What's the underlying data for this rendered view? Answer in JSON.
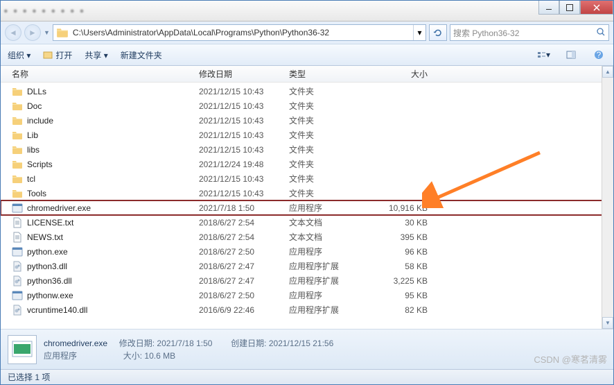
{
  "address_path": "C:\\Users\\Administrator\\AppData\\Local\\Programs\\Python\\Python36-32",
  "search_placeholder": "搜索 Python36-32",
  "toolbar": {
    "organize": "组织 ▾",
    "open": "打开",
    "share": "共享 ▾",
    "newfolder": "新建文件夹"
  },
  "columns": {
    "name": "名称",
    "date": "修改日期",
    "type": "类型",
    "size": "大小"
  },
  "files": [
    {
      "icon": "folder",
      "name": "DLLs",
      "date": "2021/12/15 10:43",
      "type": "文件夹",
      "size": ""
    },
    {
      "icon": "folder",
      "name": "Doc",
      "date": "2021/12/15 10:43",
      "type": "文件夹",
      "size": ""
    },
    {
      "icon": "folder",
      "name": "include",
      "date": "2021/12/15 10:43",
      "type": "文件夹",
      "size": ""
    },
    {
      "icon": "folder",
      "name": "Lib",
      "date": "2021/12/15 10:43",
      "type": "文件夹",
      "size": ""
    },
    {
      "icon": "folder",
      "name": "libs",
      "date": "2021/12/15 10:43",
      "type": "文件夹",
      "size": ""
    },
    {
      "icon": "folder",
      "name": "Scripts",
      "date": "2021/12/24 19:48",
      "type": "文件夹",
      "size": ""
    },
    {
      "icon": "folder",
      "name": "tcl",
      "date": "2021/12/15 10:43",
      "type": "文件夹",
      "size": ""
    },
    {
      "icon": "folder",
      "name": "Tools",
      "date": "2021/12/15 10:43",
      "type": "文件夹",
      "size": ""
    },
    {
      "icon": "app",
      "name": "chromedriver.exe",
      "date": "2021/7/18 1:50",
      "type": "应用程序",
      "size": "10,916 KB",
      "selected": true
    },
    {
      "icon": "txt",
      "name": "LICENSE.txt",
      "date": "2018/6/27 2:54",
      "type": "文本文档",
      "size": "30 KB"
    },
    {
      "icon": "txt",
      "name": "NEWS.txt",
      "date": "2018/6/27 2:54",
      "type": "文本文档",
      "size": "395 KB"
    },
    {
      "icon": "app",
      "name": "python.exe",
      "date": "2018/6/27 2:50",
      "type": "应用程序",
      "size": "96 KB"
    },
    {
      "icon": "dll",
      "name": "python3.dll",
      "date": "2018/6/27 2:47",
      "type": "应用程序扩展",
      "size": "58 KB"
    },
    {
      "icon": "dll",
      "name": "python36.dll",
      "date": "2018/6/27 2:47",
      "type": "应用程序扩展",
      "size": "3,225 KB"
    },
    {
      "icon": "app",
      "name": "pythonw.exe",
      "date": "2018/6/27 2:50",
      "type": "应用程序",
      "size": "95 KB"
    },
    {
      "icon": "dll",
      "name": "vcruntime140.dll",
      "date": "2016/6/9 22:46",
      "type": "应用程序扩展",
      "size": "82 KB"
    }
  ],
  "details": {
    "filename": "chromedriver.exe",
    "filetype": "应用程序",
    "modlabel": "修改日期:",
    "modval": "2021/7/18 1:50",
    "sizelabel": "大小:",
    "sizeval": "10.6 MB",
    "createlabel": "创建日期:",
    "createval": "2021/12/15 21:56"
  },
  "status": "已选择 1 项",
  "watermark": "CSDN @寒茗清雾"
}
